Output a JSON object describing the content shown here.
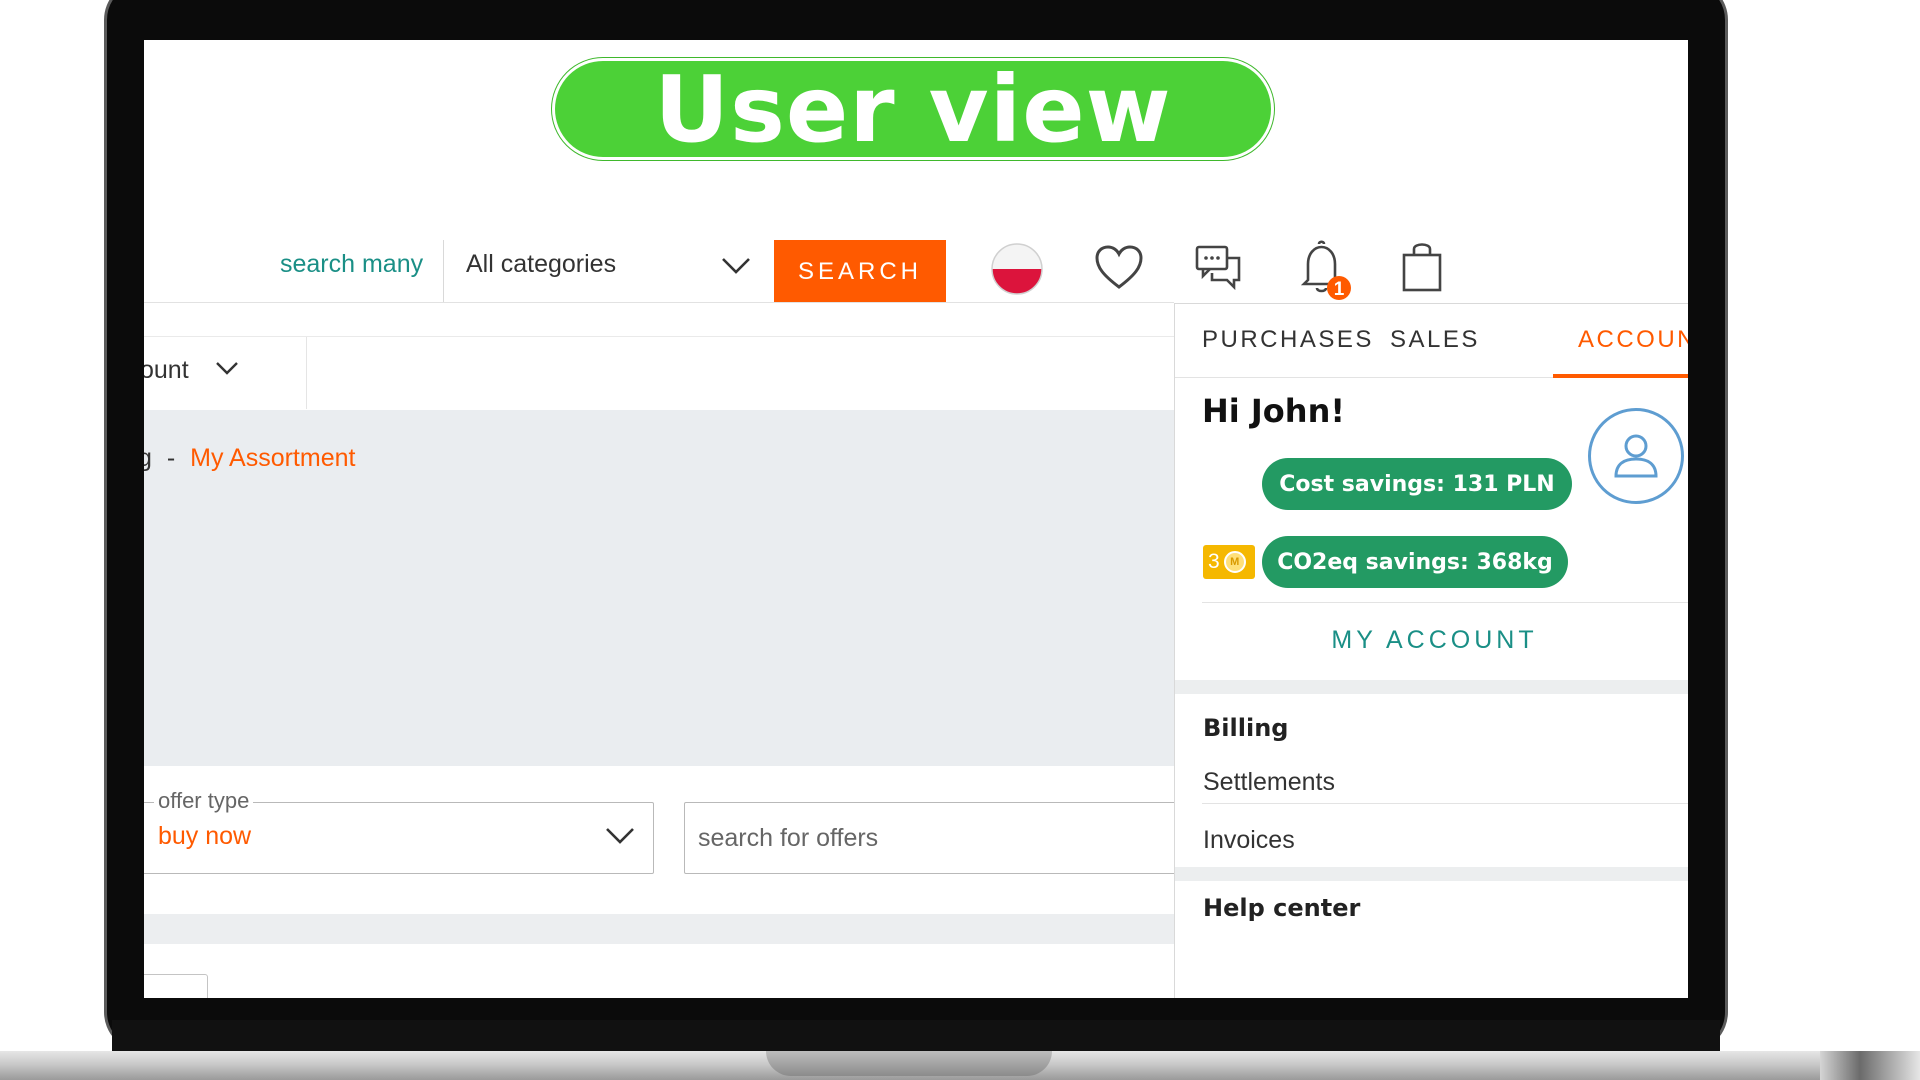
{
  "banner": {
    "title": "User view"
  },
  "search": {
    "hint": "search many",
    "category": "All categories",
    "button": "SEARCH"
  },
  "header_icons": [
    "poland-flag-icon",
    "heart-icon",
    "chat-icon",
    "bell-icon",
    "shopping-bag-icon"
  ],
  "notifications": {
    "count": "1"
  },
  "account_row": {
    "label": "ount"
  },
  "breadcrumb": {
    "prefix": "g",
    "separator": "-",
    "current": "My Assortment"
  },
  "filters": {
    "offer_type_label": "offer type",
    "offer_type_value": "buy now",
    "search_placeholder": "search for offers"
  },
  "dropdown": {
    "tabs": [
      {
        "label": "PURCHASES"
      },
      {
        "label": "SALES"
      },
      {
        "label": "ACCOUN"
      }
    ],
    "greeting": "Hi John!",
    "cost_savings": "Cost savings: 131 PLN",
    "co2_savings": "CO2eq savings: 368kg",
    "coins": "3",
    "coin_symbol": "M",
    "my_account": "MY ACCOUNT",
    "billing": {
      "title": "Billing",
      "items": [
        "Settlements",
        "Invoices"
      ]
    },
    "help_center": "Help center"
  },
  "colors": {
    "accent": "#ff5a00",
    "teal": "#1a8f86",
    "banner": "#4cd137",
    "pill": "#239a63",
    "coin": "#f5b800"
  }
}
